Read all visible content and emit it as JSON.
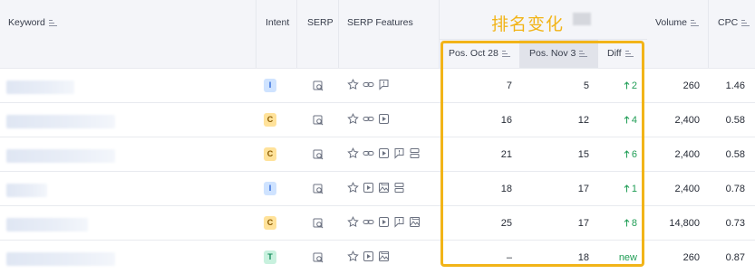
{
  "columns": {
    "keyword": "Keyword",
    "intent": "Intent",
    "serp": "SERP",
    "serp_features": "SERP Features",
    "pos_oct": "Pos. Oct 28",
    "pos_nov": "Pos. Nov 3",
    "diff": "Diff",
    "volume": "Volume",
    "cpc": "CPC"
  },
  "overlay": {
    "title": "排名变化"
  },
  "colors": {
    "overlay_border": "#f2b418",
    "diff_positive": "#1f9d55",
    "intent_I_bg": "#cfe3ff",
    "intent_I_fg": "#2563d8",
    "intent_C_bg": "#ffe29a",
    "intent_C_fg": "#8a5a00",
    "intent_T_bg": "#c8f1de",
    "intent_T_fg": "#138a5a"
  },
  "rows": [
    {
      "intent": "I",
      "features": [
        "star-icon",
        "link-icon",
        "comment-icon"
      ],
      "pos_oct": "7",
      "pos_nov": "5",
      "diff": "2",
      "diff_type": "up",
      "volume": "260",
      "cpc": "1.46"
    },
    {
      "intent": "C",
      "features": [
        "star-icon",
        "link-icon",
        "video-icon"
      ],
      "pos_oct": "16",
      "pos_nov": "12",
      "diff": "4",
      "diff_type": "up",
      "volume": "2,400",
      "cpc": "0.58"
    },
    {
      "intent": "C",
      "features": [
        "star-icon",
        "link-icon",
        "video-icon",
        "comment-icon",
        "layout-icon"
      ],
      "pos_oct": "21",
      "pos_nov": "15",
      "diff": "6",
      "diff_type": "up",
      "volume": "2,400",
      "cpc": "0.58"
    },
    {
      "intent": "I",
      "features": [
        "star-icon",
        "video-icon",
        "image-icon",
        "layout-icon"
      ],
      "pos_oct": "18",
      "pos_nov": "17",
      "diff": "1",
      "diff_type": "up",
      "volume": "2,400",
      "cpc": "0.78"
    },
    {
      "intent": "C",
      "features": [
        "star-icon",
        "link-icon",
        "video-icon",
        "comment-icon",
        "image-icon"
      ],
      "pos_oct": "25",
      "pos_nov": "17",
      "diff": "8",
      "diff_type": "up",
      "volume": "14,800",
      "cpc": "0.73"
    },
    {
      "intent": "T",
      "features": [
        "star-icon",
        "video-icon",
        "image-icon"
      ],
      "pos_oct": "–",
      "pos_nov": "18",
      "diff": "new",
      "diff_type": "new",
      "volume": "260",
      "cpc": "0.87"
    }
  ]
}
